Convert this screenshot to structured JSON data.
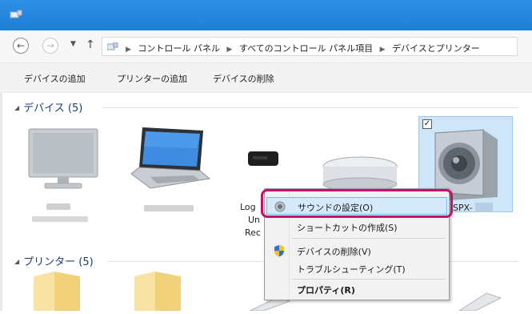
{
  "window": {
    "title_bar_color": "#1f7fd8"
  },
  "navigation": {
    "back_icon": "back-arrow-icon",
    "forward_icon": "forward-arrow-icon",
    "recent_icon": "chevron-down-icon",
    "up_icon": "up-arrow-icon",
    "breadcrumb": [
      "コントロール パネル",
      "すべてのコントロール パネル項目",
      "デバイスとプリンター"
    ]
  },
  "toolbar": {
    "add_device": "デバイスの追加",
    "add_printer": "プリンターの追加",
    "remove_device": "デバイスの削除"
  },
  "groups": {
    "devices_header": "デバイス (5)",
    "printers_header": "プリンター (5)"
  },
  "devices": {
    "partial_label_line1": "Log",
    "partial_label_line2": "Un",
    "partial_label_line3": "Rec",
    "selected_label_fragment": "SPX-"
  },
  "context_menu": {
    "items": [
      {
        "label": "サウンドの設定(O)",
        "icon": "speaker-icon"
      },
      {
        "label": "ショートカットの作成(S)",
        "icon": ""
      },
      {
        "label": "デバイスの削除(V)",
        "icon": "shield-icon"
      },
      {
        "label": "トラブルシューティング(T)",
        "icon": ""
      },
      {
        "label": "プロパティ(R)",
        "icon": ""
      }
    ],
    "highlight_color": "#c2126e"
  }
}
